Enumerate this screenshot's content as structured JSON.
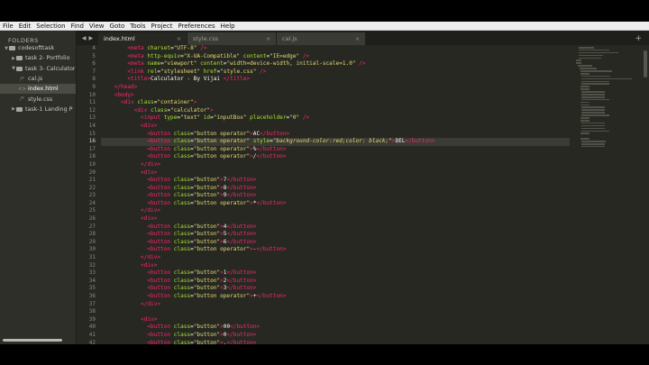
{
  "menu": [
    "File",
    "Edit",
    "Selection",
    "Find",
    "View",
    "Goto",
    "Tools",
    "Project",
    "Preferences",
    "Help"
  ],
  "sidebar": {
    "header": "FOLDERS",
    "items": [
      {
        "label": "codesofttask",
        "type": "folder",
        "expanded": true,
        "indent": 0,
        "active": false
      },
      {
        "label": "task 2- Portfolio",
        "type": "folder",
        "expanded": false,
        "indent": 1,
        "active": false
      },
      {
        "label": "task 3- Calculator",
        "type": "folder",
        "expanded": true,
        "indent": 1,
        "active": false
      },
      {
        "label": "cal.js",
        "type": "file",
        "glyph": "/*",
        "indent": 2,
        "active": false
      },
      {
        "label": "index.html",
        "type": "file",
        "glyph": "<>",
        "indent": 2,
        "active": true
      },
      {
        "label": "style.css",
        "type": "file",
        "glyph": "/*",
        "indent": 2,
        "active": false
      },
      {
        "label": "task-1 Landing P",
        "type": "folder",
        "expanded": false,
        "indent": 1,
        "active": false
      }
    ]
  },
  "tabs": [
    {
      "label": "index.html",
      "active": true
    },
    {
      "label": "style.css",
      "active": false
    },
    {
      "label": "cal.js",
      "active": false
    }
  ],
  "editor": {
    "current_line": 16,
    "lines": [
      {
        "n": 4,
        "indent": "        ",
        "tokens": [
          [
            "tag",
            "<meta "
          ],
          [
            "attr",
            "charset"
          ],
          [
            "txt",
            "="
          ],
          [
            "str",
            "\"UTF-8\""
          ],
          [
            "tag",
            " />"
          ]
        ]
      },
      {
        "n": 5,
        "indent": "        ",
        "tokens": [
          [
            "tag",
            "<meta "
          ],
          [
            "attr",
            "http-equiv"
          ],
          [
            "txt",
            "="
          ],
          [
            "str",
            "\"X-UA-Compatible\""
          ],
          [
            "attr",
            " content"
          ],
          [
            "txt",
            "="
          ],
          [
            "str",
            "\"IE=edge\""
          ],
          [
            "tag",
            " />"
          ]
        ]
      },
      {
        "n": 6,
        "indent": "        ",
        "tokens": [
          [
            "tag",
            "<meta "
          ],
          [
            "attr",
            "name"
          ],
          [
            "txt",
            "="
          ],
          [
            "str",
            "\"viewport\""
          ],
          [
            "attr",
            " content"
          ],
          [
            "txt",
            "="
          ],
          [
            "str",
            "\"width=device-width, initial-scale=1.0\""
          ],
          [
            "tag",
            " />"
          ]
        ]
      },
      {
        "n": 7,
        "indent": "        ",
        "tokens": [
          [
            "tag",
            "<link "
          ],
          [
            "attr",
            "rel"
          ],
          [
            "txt",
            "="
          ],
          [
            "str",
            "\"stylesheet\""
          ],
          [
            "attr",
            " href"
          ],
          [
            "txt",
            "="
          ],
          [
            "str",
            "\"style.css\""
          ],
          [
            "tag",
            " />"
          ]
        ]
      },
      {
        "n": 8,
        "indent": "        ",
        "tokens": [
          [
            "tag",
            "<title>"
          ],
          [
            "txt",
            "Calculator - By Vijai "
          ],
          [
            "tag",
            "</title>"
          ]
        ]
      },
      {
        "n": 9,
        "indent": "    ",
        "tokens": [
          [
            "tag",
            "</head>"
          ]
        ]
      },
      {
        "n": 10,
        "indent": "    ",
        "tokens": [
          [
            "tag",
            "<body>"
          ]
        ]
      },
      {
        "n": 11,
        "indent": "      ",
        "tokens": [
          [
            "tag",
            "<div "
          ],
          [
            "attr",
            "class"
          ],
          [
            "txt",
            "="
          ],
          [
            "str",
            "\"container\""
          ],
          [
            "tag",
            ">"
          ]
        ]
      },
      {
        "n": 12,
        "indent": "          ",
        "tokens": [
          [
            "tag",
            "<div "
          ],
          [
            "attr",
            "class"
          ],
          [
            "txt",
            "="
          ],
          [
            "str",
            "\"calculator\""
          ],
          [
            "tag",
            ">"
          ]
        ]
      },
      {
        "n": 13,
        "indent": "            ",
        "tokens": [
          [
            "tag",
            "<input "
          ],
          [
            "attr",
            "type"
          ],
          [
            "txt",
            "="
          ],
          [
            "str",
            "\"text\""
          ],
          [
            "attr",
            " id"
          ],
          [
            "txt",
            "="
          ],
          [
            "str",
            "\"inputBox\""
          ],
          [
            "attr",
            " placeholder"
          ],
          [
            "txt",
            "="
          ],
          [
            "str",
            "\"0\""
          ],
          [
            "tag",
            " />"
          ]
        ]
      },
      {
        "n": 14,
        "indent": "            ",
        "tokens": [
          [
            "tag",
            "<div>"
          ]
        ]
      },
      {
        "n": 15,
        "indent": "              ",
        "tokens": [
          [
            "tag",
            "<button "
          ],
          [
            "attr",
            "class"
          ],
          [
            "txt",
            "="
          ],
          [
            "str",
            "\"button operator\""
          ],
          [
            "tag",
            ">"
          ],
          [
            "txt",
            "AC"
          ],
          [
            "tag",
            "</button>"
          ]
        ]
      },
      {
        "n": 16,
        "indent": "              ",
        "tokens": [
          [
            "tag",
            "<button "
          ],
          [
            "attr",
            "class"
          ],
          [
            "txt",
            "="
          ],
          [
            "str",
            "\"button operator\""
          ],
          [
            "attr",
            " style"
          ],
          [
            "txt",
            "="
          ],
          [
            "str",
            "\""
          ],
          [
            "ital",
            "background-color:red;color: black;"
          ],
          [
            "str",
            "\""
          ],
          [
            "tag",
            ">"
          ],
          [
            "txt",
            "DEL"
          ],
          [
            "tag",
            "</button>"
          ]
        ]
      },
      {
        "n": 17,
        "indent": "              ",
        "tokens": [
          [
            "tag",
            "<button "
          ],
          [
            "attr",
            "class"
          ],
          [
            "txt",
            "="
          ],
          [
            "str",
            "\"button operator\""
          ],
          [
            "tag",
            ">"
          ],
          [
            "txt",
            "%"
          ],
          [
            "tag",
            "</button>"
          ]
        ]
      },
      {
        "n": 18,
        "indent": "              ",
        "tokens": [
          [
            "tag",
            "<button "
          ],
          [
            "attr",
            "class"
          ],
          [
            "txt",
            "="
          ],
          [
            "str",
            "\"button operator\""
          ],
          [
            "tag",
            ">"
          ],
          [
            "txt",
            "/"
          ],
          [
            "tag",
            "</button>"
          ]
        ]
      },
      {
        "n": 19,
        "indent": "            ",
        "tokens": [
          [
            "tag",
            "</div>"
          ]
        ]
      },
      {
        "n": 20,
        "indent": "            ",
        "tokens": [
          [
            "tag",
            "<div>"
          ]
        ]
      },
      {
        "n": 21,
        "indent": "              ",
        "tokens": [
          [
            "tag",
            "<button "
          ],
          [
            "attr",
            "class"
          ],
          [
            "txt",
            "="
          ],
          [
            "str",
            "\"button\""
          ],
          [
            "tag",
            ">"
          ],
          [
            "txt",
            "7"
          ],
          [
            "tag",
            "</button>"
          ]
        ]
      },
      {
        "n": 22,
        "indent": "              ",
        "tokens": [
          [
            "tag",
            "<button "
          ],
          [
            "attr",
            "class"
          ],
          [
            "txt",
            "="
          ],
          [
            "str",
            "\"button\""
          ],
          [
            "tag",
            ">"
          ],
          [
            "txt",
            "8"
          ],
          [
            "tag",
            "</button>"
          ]
        ]
      },
      {
        "n": 23,
        "indent": "              ",
        "tokens": [
          [
            "tag",
            "<button "
          ],
          [
            "attr",
            "class"
          ],
          [
            "txt",
            "="
          ],
          [
            "str",
            "\"button\""
          ],
          [
            "tag",
            ">"
          ],
          [
            "txt",
            "9"
          ],
          [
            "tag",
            "</button>"
          ]
        ]
      },
      {
        "n": 24,
        "indent": "              ",
        "tokens": [
          [
            "tag",
            "<button "
          ],
          [
            "attr",
            "class"
          ],
          [
            "txt",
            "="
          ],
          [
            "str",
            "\"button operator\""
          ],
          [
            "tag",
            ">"
          ],
          [
            "txt",
            "*"
          ],
          [
            "tag",
            "</button>"
          ]
        ]
      },
      {
        "n": 25,
        "indent": "            ",
        "tokens": [
          [
            "tag",
            "</div>"
          ]
        ]
      },
      {
        "n": 26,
        "indent": "            ",
        "tokens": [
          [
            "tag",
            "<div>"
          ]
        ]
      },
      {
        "n": 27,
        "indent": "              ",
        "tokens": [
          [
            "tag",
            "<button "
          ],
          [
            "attr",
            "class"
          ],
          [
            "txt",
            "="
          ],
          [
            "str",
            "\"button\""
          ],
          [
            "tag",
            ">"
          ],
          [
            "txt",
            "4"
          ],
          [
            "tag",
            "</button>"
          ]
        ]
      },
      {
        "n": 28,
        "indent": "              ",
        "tokens": [
          [
            "tag",
            "<button "
          ],
          [
            "attr",
            "class"
          ],
          [
            "txt",
            "="
          ],
          [
            "str",
            "\"button\""
          ],
          [
            "tag",
            ">"
          ],
          [
            "txt",
            "5"
          ],
          [
            "tag",
            "</button>"
          ]
        ]
      },
      {
        "n": 29,
        "indent": "              ",
        "tokens": [
          [
            "tag",
            "<button "
          ],
          [
            "attr",
            "class"
          ],
          [
            "txt",
            "="
          ],
          [
            "str",
            "\"button\""
          ],
          [
            "tag",
            ">"
          ],
          [
            "txt",
            "6"
          ],
          [
            "tag",
            "</button>"
          ]
        ]
      },
      {
        "n": 30,
        "indent": "              ",
        "tokens": [
          [
            "tag",
            "<button "
          ],
          [
            "attr",
            "class"
          ],
          [
            "txt",
            "="
          ],
          [
            "str",
            "\"button operator\""
          ],
          [
            "tag",
            ">"
          ],
          [
            "txt",
            "-"
          ],
          [
            "tag",
            "</button>"
          ]
        ]
      },
      {
        "n": 31,
        "indent": "            ",
        "tokens": [
          [
            "tag",
            "</div>"
          ]
        ]
      },
      {
        "n": 32,
        "indent": "            ",
        "tokens": [
          [
            "tag",
            "<div>"
          ]
        ]
      },
      {
        "n": 33,
        "indent": "              ",
        "tokens": [
          [
            "tag",
            "<button "
          ],
          [
            "attr",
            "class"
          ],
          [
            "txt",
            "="
          ],
          [
            "str",
            "\"button\""
          ],
          [
            "tag",
            ">"
          ],
          [
            "txt",
            "1"
          ],
          [
            "tag",
            "</button>"
          ]
        ]
      },
      {
        "n": 34,
        "indent": "              ",
        "tokens": [
          [
            "tag",
            "<button "
          ],
          [
            "attr",
            "class"
          ],
          [
            "txt",
            "="
          ],
          [
            "str",
            "\"button\""
          ],
          [
            "tag",
            ">"
          ],
          [
            "txt",
            "2"
          ],
          [
            "tag",
            "</button>"
          ]
        ]
      },
      {
        "n": 35,
        "indent": "              ",
        "tokens": [
          [
            "tag",
            "<button "
          ],
          [
            "attr",
            "class"
          ],
          [
            "txt",
            "="
          ],
          [
            "str",
            "\"button\""
          ],
          [
            "tag",
            ">"
          ],
          [
            "txt",
            "3"
          ],
          [
            "tag",
            "</button>"
          ]
        ]
      },
      {
        "n": 36,
        "indent": "              ",
        "tokens": [
          [
            "tag",
            "<button "
          ],
          [
            "attr",
            "class"
          ],
          [
            "txt",
            "="
          ],
          [
            "str",
            "\"button operator\""
          ],
          [
            "tag",
            ">"
          ],
          [
            "txt",
            "+"
          ],
          [
            "tag",
            "</button>"
          ]
        ]
      },
      {
        "n": 37,
        "indent": "            ",
        "tokens": [
          [
            "tag",
            "</div>"
          ]
        ]
      },
      {
        "n": 38,
        "indent": "",
        "tokens": []
      },
      {
        "n": 39,
        "indent": "            ",
        "tokens": [
          [
            "tag",
            "<div>"
          ]
        ]
      },
      {
        "n": 40,
        "indent": "              ",
        "tokens": [
          [
            "tag",
            "<button "
          ],
          [
            "attr",
            "class"
          ],
          [
            "txt",
            "="
          ],
          [
            "str",
            "\"button\""
          ],
          [
            "tag",
            ">"
          ],
          [
            "txt",
            "00"
          ],
          [
            "tag",
            "</button>"
          ]
        ]
      },
      {
        "n": 41,
        "indent": "              ",
        "tokens": [
          [
            "tag",
            "<button "
          ],
          [
            "attr",
            "class"
          ],
          [
            "txt",
            "="
          ],
          [
            "str",
            "\"button\""
          ],
          [
            "tag",
            ">"
          ],
          [
            "txt",
            "0"
          ],
          [
            "tag",
            "</button>"
          ]
        ]
      },
      {
        "n": 42,
        "indent": "              ",
        "tokens": [
          [
            "tag",
            "<button "
          ],
          [
            "attr",
            "class"
          ],
          [
            "txt",
            "="
          ],
          [
            "str",
            "\"button\""
          ],
          [
            "tag",
            ">"
          ],
          [
            "txt",
            "."
          ],
          [
            "tag",
            "</button>"
          ]
        ]
      }
    ]
  },
  "colors": {
    "tag": "#f92672",
    "attr": "#a6e22e",
    "string": "#e6db74",
    "text": "#f8f8f2",
    "background": "#272822"
  }
}
